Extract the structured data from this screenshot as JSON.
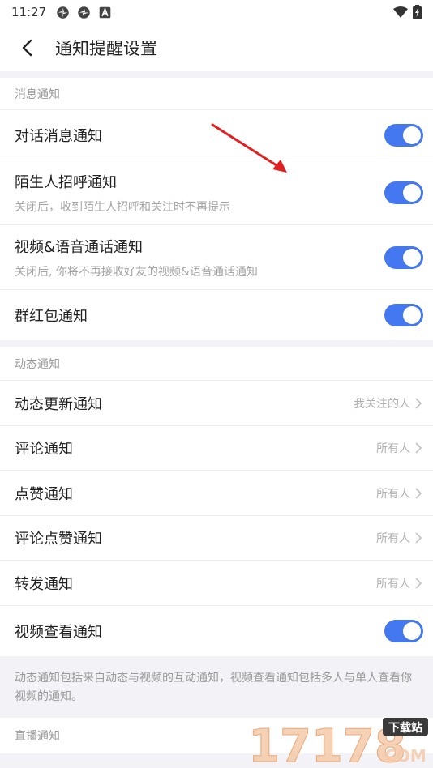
{
  "status_bar": {
    "time": "11:27"
  },
  "header": {
    "title": "通知提醒设置"
  },
  "message_section": {
    "title": "消息通知",
    "items": [
      {
        "label": "对话消息通知",
        "enabled": true
      },
      {
        "label": "陌生人招呼通知",
        "sub": "关闭后，收到陌生人招呼和关注时不再提示",
        "enabled": true
      },
      {
        "label": "视频&语音通话通知",
        "sub": "关闭后, 你将不再接收好友的视频&语音通话通知",
        "enabled": true
      },
      {
        "label": "群红包通知",
        "enabled": true
      }
    ]
  },
  "dynamic_section": {
    "title": "动态通知",
    "items": [
      {
        "label": "动态更新通知",
        "value": "我关注的人"
      },
      {
        "label": "评论通知",
        "value": "所有人"
      },
      {
        "label": "点赞通知",
        "value": "所有人"
      },
      {
        "label": "评论点赞通知",
        "value": "所有人"
      },
      {
        "label": "转发通知",
        "value": "所有人"
      },
      {
        "label": "视频查看通知",
        "enabled": true
      }
    ],
    "note": "动态通知包括来自动态与视频的互动通知，视频查看通知包括多人与单人查看你视频的通知。"
  },
  "live_section": {
    "title": "直播通知"
  },
  "watermark": {
    "text": "17178",
    "badge": "下载站",
    "domain": "COM"
  },
  "colors": {
    "accent": "#4478f0",
    "arrow": "#e02020"
  }
}
